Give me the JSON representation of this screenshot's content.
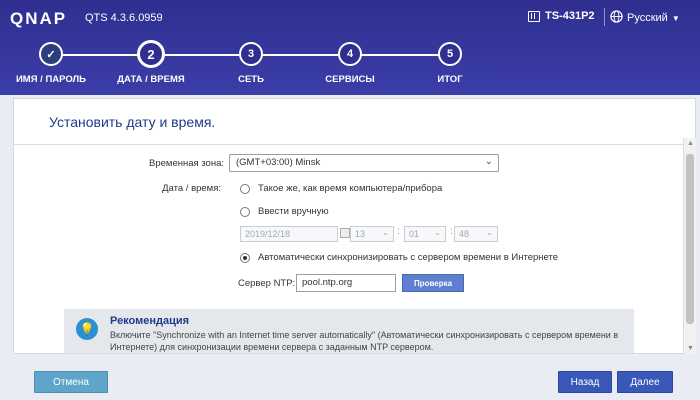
{
  "header": {
    "logo": "QNAP",
    "version": "QTS 4.3.6.0959",
    "model": "TS-431P2",
    "language": "Русский"
  },
  "steps": [
    {
      "number": "✓",
      "label": "ИМЯ / ПАРОЛЬ",
      "state": "done"
    },
    {
      "number": "2",
      "label": "ДАТА / ВРЕМЯ",
      "state": "active"
    },
    {
      "number": "3",
      "label": "СЕТЬ",
      "state": "pending"
    },
    {
      "number": "4",
      "label": "СЕРВИСЫ",
      "state": "pending"
    },
    {
      "number": "5",
      "label": "ИТОГ",
      "state": "pending"
    }
  ],
  "panel": {
    "title": "Установить дату и время.",
    "timezone_label": "Временная зона:",
    "timezone_value": "(GMT+03:00) Minsk",
    "datetime_label": "Дата / время:",
    "option_same": "Такое же, как время компьютера/прибора",
    "option_manual": "Ввести вручную",
    "manual_date": "2019/12/18",
    "manual_hour": "13",
    "manual_minute": "01",
    "manual_second": "48",
    "option_ntp": "Автоматически синхронизировать с сервером времени в Интернете",
    "selected_option": "ntp",
    "ntp_label": "Сервер NTP:",
    "ntp_value": "pool.ntp.org",
    "check_button": "Проверка"
  },
  "recommendation": {
    "title": "Рекомендация",
    "text": "Включите \"Synchronize with an Internet time server automatically\" (Автоматически синхронизировать с сервером времени в Интернете) для синхронизации времени сервера с заданным NTP сервером."
  },
  "footer": {
    "cancel": "Отмена",
    "back": "Назад",
    "next": "Далее"
  },
  "colors": {
    "header_bg": "#2e2f8f",
    "primary_button": "#3a58b8",
    "cancel_button": "#5fa5c9",
    "title_text": "#1f3c88"
  }
}
